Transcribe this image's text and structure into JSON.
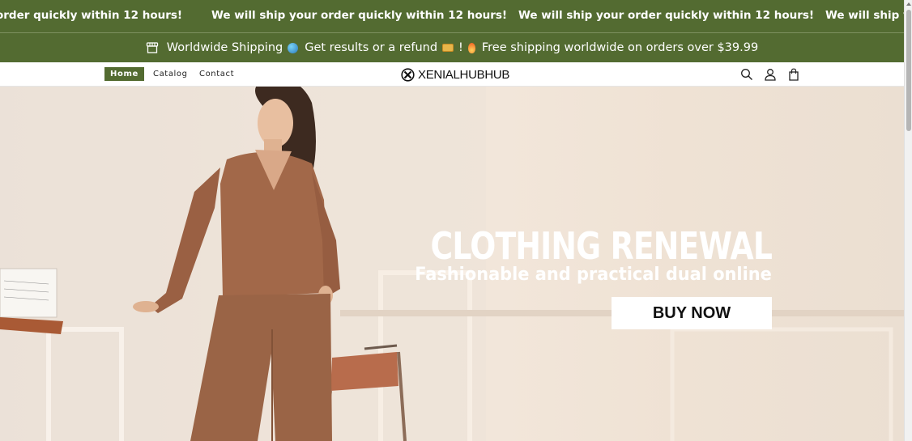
{
  "marquee": {
    "items": [
      "order quickly within 12 hours!",
      "We will ship your order quickly within 12 hours!",
      "We will ship your order quickly within 12 hours!",
      "We will ship yo"
    ]
  },
  "announcement": {
    "part1": "Worldwide Shipping",
    "part2": "Get results or a refund",
    "part3": "!",
    "part4": "Free shipping worldwide on orders over $39.99"
  },
  "nav": {
    "home": "Home",
    "catalog": "Catalog",
    "contact": "Contact"
  },
  "brand": {
    "name": "XENIALHUBHUB"
  },
  "hero": {
    "title": "CLOTHING RENEWAL",
    "subtitle": "Fashionable and practical dual online",
    "cta": "BUY NOW"
  },
  "colors": {
    "brand_green": "#536b31",
    "hero_button": "#ffffff"
  },
  "icons": [
    "store-icon",
    "globe-icon",
    "money-icon",
    "fire-icon",
    "search-icon",
    "account-icon",
    "cart-icon",
    "logo-mark-icon"
  ]
}
